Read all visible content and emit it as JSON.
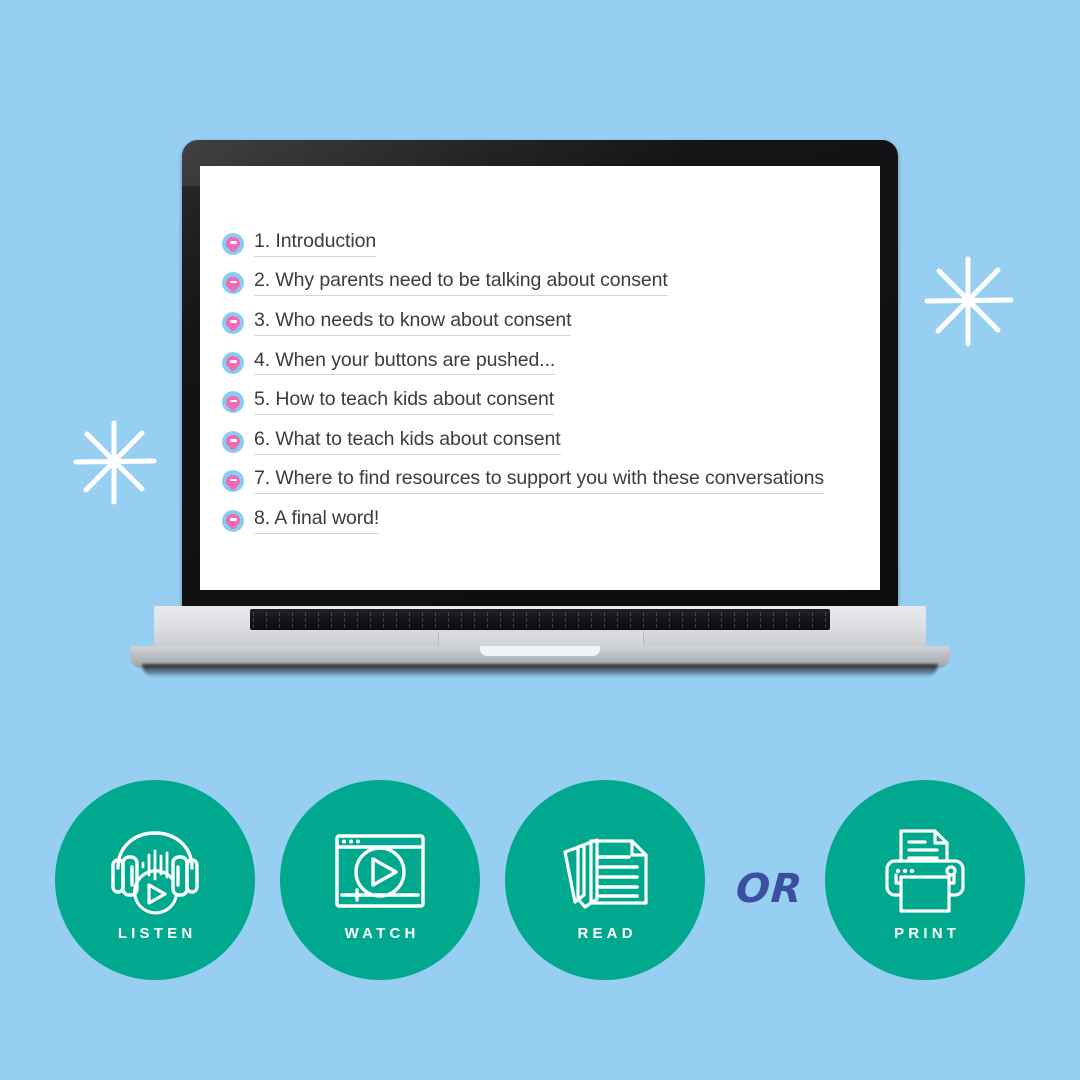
{
  "theme": {
    "background_color": "#96cff1",
    "accent_color": "#00a88e",
    "bullet_circle_color": "#87cdf2",
    "bullet_mark_color": "#f269b4",
    "text_color": "#3c3c3c",
    "or_text_color": "#3b4fa0",
    "caption_color": "#ffffff"
  },
  "laptop": {
    "screen": {
      "toc": {
        "items": [
          {
            "number": "1.",
            "label": "1. Introduction"
          },
          {
            "number": "2.",
            "label": "2. Why parents need to be talking about consent"
          },
          {
            "number": "3.",
            "label": "3. Who needs to know about consent"
          },
          {
            "number": "4.",
            "label": "4. When your buttons are pushed..."
          },
          {
            "number": "5.",
            "label": "5. How to teach kids about consent"
          },
          {
            "number": "6.",
            "label": "6. What to teach kids about consent"
          },
          {
            "number": "7.",
            "label": "7. Where to find resources to support you with these conversations"
          },
          {
            "number": "8.",
            "label": "8. A final word!"
          }
        ]
      }
    }
  },
  "actions": [
    {
      "id": "listen",
      "caption": "LISTEN",
      "icon": "headphones-play-icon"
    },
    {
      "id": "watch",
      "caption": "WATCH",
      "icon": "video-player-play-icon"
    },
    {
      "id": "read",
      "caption": "READ",
      "icon": "stacked-documents-icon"
    },
    {
      "id": "print",
      "caption": "PRINT",
      "icon": "printer-icon"
    }
  ],
  "or_label": "OR",
  "decorations": [
    {
      "id": "sparkle-right",
      "icon": "sparkle-icon"
    },
    {
      "id": "sparkle-left",
      "icon": "sparkle-icon"
    }
  ]
}
